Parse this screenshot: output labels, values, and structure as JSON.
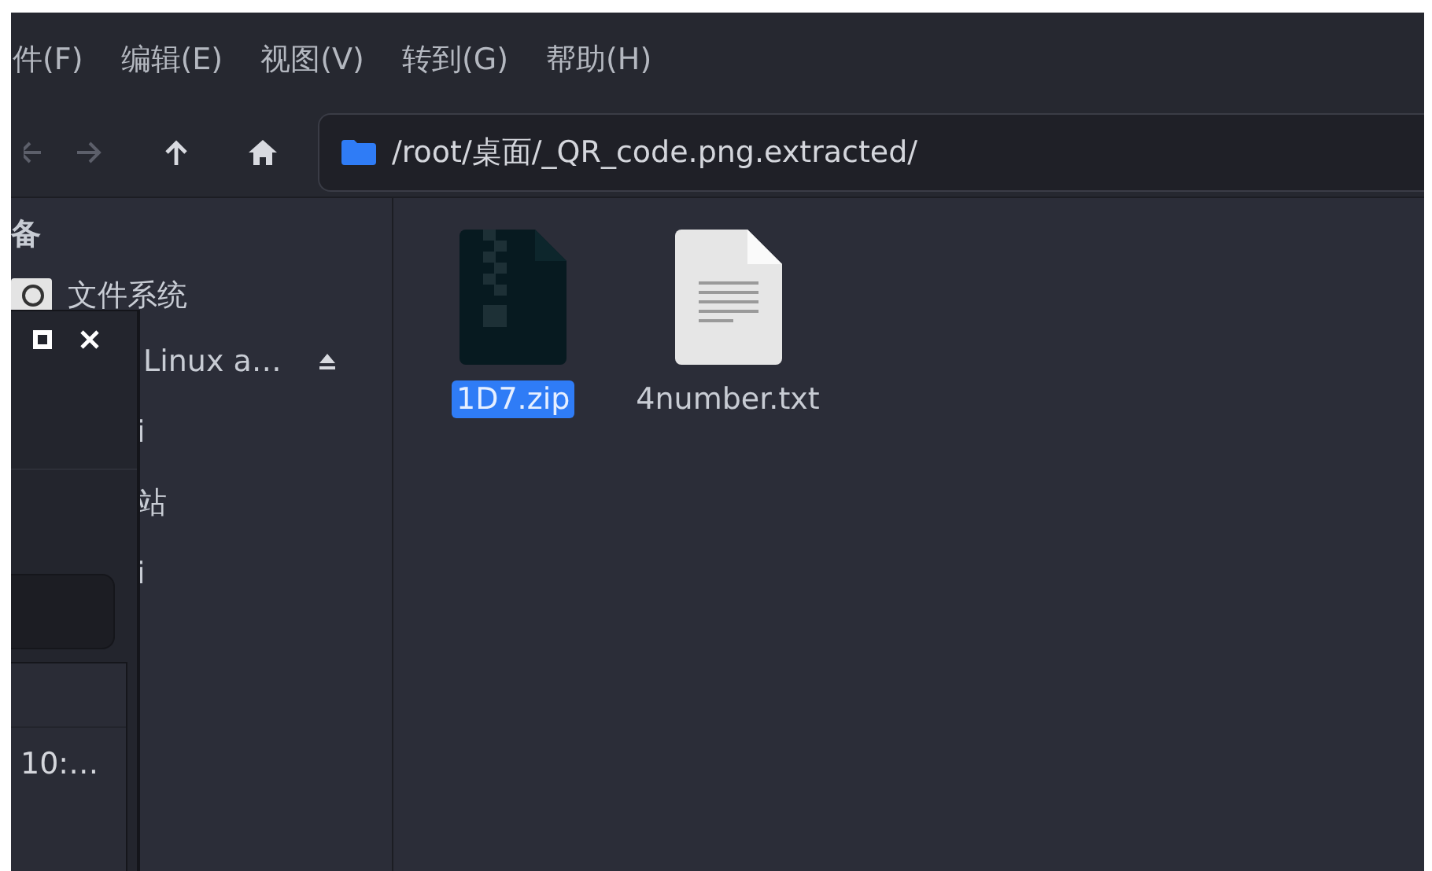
{
  "menu": [
    "件(F)",
    "编辑(E)",
    "视图(V)",
    "转到(G)",
    "帮助(H)"
  ],
  "toolbar": {
    "buttons": [
      {
        "kind": "back",
        "disabled": true
      },
      {
        "kind": "forward",
        "disabled": true
      },
      {
        "kind": "up",
        "disabled": false
      },
      {
        "kind": "home",
        "disabled": false
      }
    ],
    "path": "/root/桌面/_QR_code.png.extracted/"
  },
  "sidebar": {
    "heading": "备",
    "items": [
      {
        "kind": "drive",
        "label": "文件系统"
      },
      {
        "kind": "eject",
        "label": "Linux a…"
      },
      {
        "kind": "plain",
        "label": "i"
      },
      {
        "kind": "plain",
        "label": "站"
      },
      {
        "kind": "plain",
        "label": "i"
      }
    ]
  },
  "files": [
    {
      "kind": "zip",
      "name": "1D7.zip",
      "selected": true
    },
    {
      "kind": "text",
      "name": "4number.txt",
      "selected": false
    }
  ],
  "overlay_window": {
    "list_text": "10:…"
  }
}
